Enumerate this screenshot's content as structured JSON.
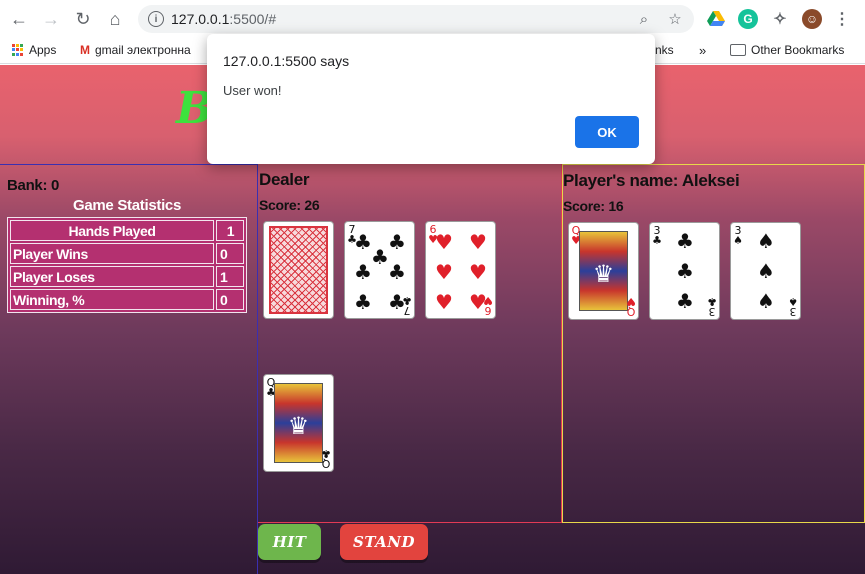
{
  "browser": {
    "url_host": "127.0.0.1",
    "url_rest": ":5500/#",
    "bookmarks": {
      "apps": "Apps",
      "gmail": "gmail электронна",
      "hidden_partial": "nks",
      "overflow": "»",
      "other": "Other Bookmarks"
    }
  },
  "alert": {
    "title": "127.0.0.1:5500 says",
    "message": "User won!",
    "ok_label": "OK"
  },
  "page": {
    "banner_letter": "B"
  },
  "stats": {
    "bank": "Bank: 0",
    "title": "Game Statistics",
    "rows": [
      {
        "label": "Hands Played",
        "value": "1"
      },
      {
        "label": "Player Wins",
        "value": "0"
      },
      {
        "label": "Player Loses",
        "value": "1"
      },
      {
        "label": "Winning, %",
        "value": "0"
      }
    ]
  },
  "dealer": {
    "title": "Dealer",
    "score": "Score: 26",
    "cards": [
      {
        "rank": "back",
        "suit": ""
      },
      {
        "rank": "7",
        "suit": "clubs"
      },
      {
        "rank": "6",
        "suit": "hearts"
      },
      {
        "rank": "Q",
        "suit": "clubs"
      }
    ]
  },
  "player": {
    "title": "Player's name: Aleksei",
    "score": "Score: 16",
    "cards": [
      {
        "rank": "Q",
        "suit": "hearts"
      },
      {
        "rank": "3",
        "suit": "clubs"
      },
      {
        "rank": "3",
        "suit": "spades"
      }
    ]
  },
  "buttons": {
    "hit": "HIT",
    "stand": "STAND"
  },
  "colors": {
    "ok_button": "#1a73e8",
    "hit_button": "#6eb64c",
    "stand_button": "#e2443e",
    "stats_table": "#b43070"
  }
}
